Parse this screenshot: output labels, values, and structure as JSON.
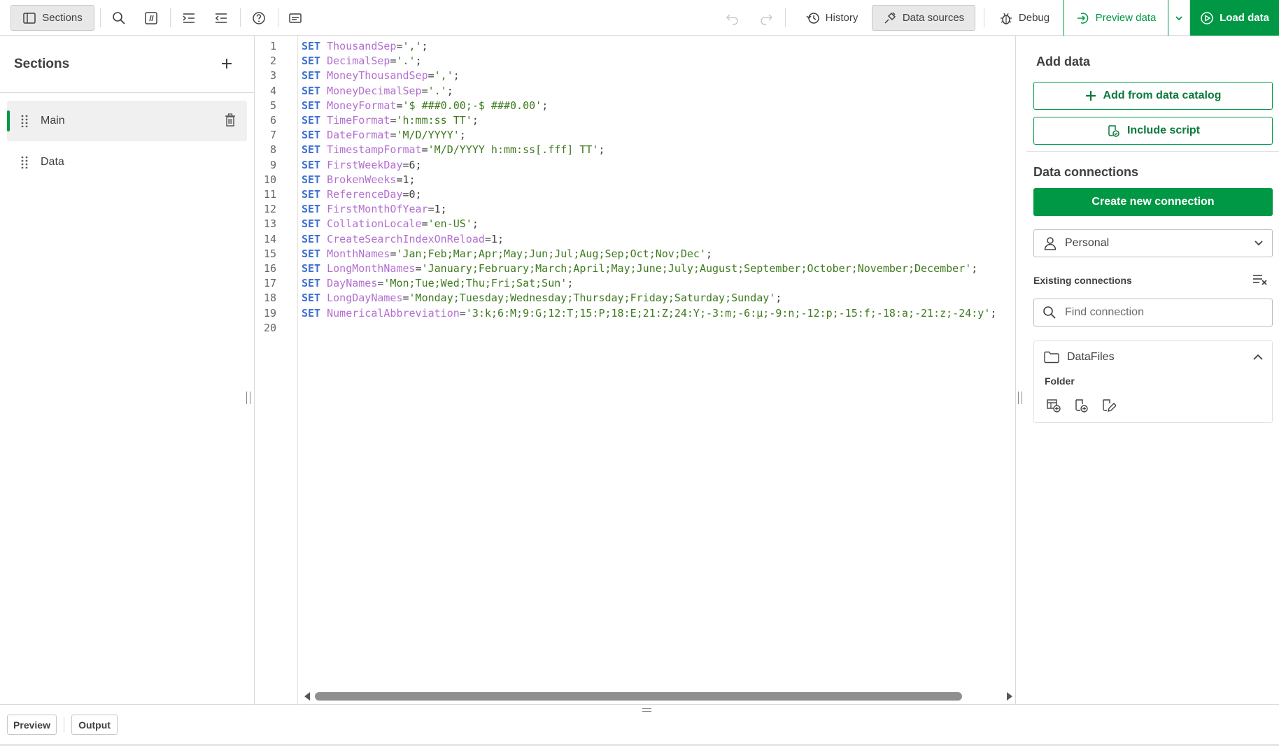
{
  "toolbar": {
    "sections_label": "Sections",
    "history_label": "History",
    "data_sources_label": "Data sources",
    "debug_label": "Debug",
    "preview_data_label": "Preview data",
    "load_data_label": "Load data"
  },
  "sections_panel": {
    "title": "Sections",
    "items": [
      {
        "label": "Main"
      },
      {
        "label": "Data"
      }
    ]
  },
  "editor": {
    "lines": [
      {
        "n": "1",
        "kw": "SET",
        "var": "ThousandSep",
        "rest": "=',';"
      },
      {
        "n": "2",
        "kw": "SET",
        "var": "DecimalSep",
        "rest": "='.';"
      },
      {
        "n": "3",
        "kw": "SET",
        "var": "MoneyThousandSep",
        "rest": "=',';"
      },
      {
        "n": "4",
        "kw": "SET",
        "var": "MoneyDecimalSep",
        "rest": "='.';"
      },
      {
        "n": "5",
        "kw": "SET",
        "var": "MoneyFormat",
        "rest": "='$ ###0.00;-$ ###0.00';"
      },
      {
        "n": "6",
        "kw": "SET",
        "var": "TimeFormat",
        "rest": "='h:mm:ss TT';"
      },
      {
        "n": "7",
        "kw": "SET",
        "var": "DateFormat",
        "rest": "='M/D/YYYY';"
      },
      {
        "n": "8",
        "kw": "SET",
        "var": "TimestampFormat",
        "rest": "='M/D/YYYY h:mm:ss[.fff] TT';"
      },
      {
        "n": "9",
        "kw": "SET",
        "var": "FirstWeekDay",
        "rest": "=6;"
      },
      {
        "n": "10",
        "kw": "SET",
        "var": "BrokenWeeks",
        "rest": "=1;"
      },
      {
        "n": "11",
        "kw": "SET",
        "var": "ReferenceDay",
        "rest": "=0;"
      },
      {
        "n": "12",
        "kw": "SET",
        "var": "FirstMonthOfYear",
        "rest": "=1;"
      },
      {
        "n": "13",
        "kw": "SET",
        "var": "CollationLocale",
        "rest": "='en-US';"
      },
      {
        "n": "14",
        "kw": "SET",
        "var": "CreateSearchIndexOnReload",
        "rest": "=1;"
      },
      {
        "n": "15",
        "kw": "SET",
        "var": "MonthNames",
        "rest": "='Jan;Feb;Mar;Apr;May;Jun;Jul;Aug;Sep;Oct;Nov;Dec';"
      },
      {
        "n": "16",
        "kw": "SET",
        "var": "LongMonthNames",
        "rest": "='January;February;March;April;May;June;July;August;September;October;November;December';"
      },
      {
        "n": "17",
        "kw": "SET",
        "var": "DayNames",
        "rest": "='Mon;Tue;Wed;Thu;Fri;Sat;Sun';"
      },
      {
        "n": "18",
        "kw": "SET",
        "var": "LongDayNames",
        "rest": "='Monday;Tuesday;Wednesday;Thursday;Friday;Saturday;Sunday';"
      },
      {
        "n": "19",
        "kw": "SET",
        "var": "NumericalAbbreviation",
        "rest": "='3:k;6:M;9:G;12:T;15:P;18:E;21:Z;24:Y;-3:m;-6:μ;-9:n;-12:p;-15:f;-18:a;-21:z;-24:y';"
      },
      {
        "n": "20",
        "kw": "",
        "var": "",
        "rest": ""
      }
    ]
  },
  "right_panel": {
    "add_data_title": "Add data",
    "add_from_catalog_label": "Add from data catalog",
    "include_script_label": "Include script",
    "data_connections_title": "Data connections",
    "create_connection_label": "Create new connection",
    "space_selected": "Personal",
    "existing_connections_label": "Existing connections",
    "find_placeholder": "Find connection",
    "connection": {
      "name": "DataFiles",
      "type": "Folder"
    }
  },
  "bottom": {
    "preview_label": "Preview",
    "output_label": "Output"
  },
  "colors": {
    "accent": "#009845",
    "keyword": "#3d6fd1",
    "variable": "#b36fd1",
    "string": "#3e7a1e"
  }
}
